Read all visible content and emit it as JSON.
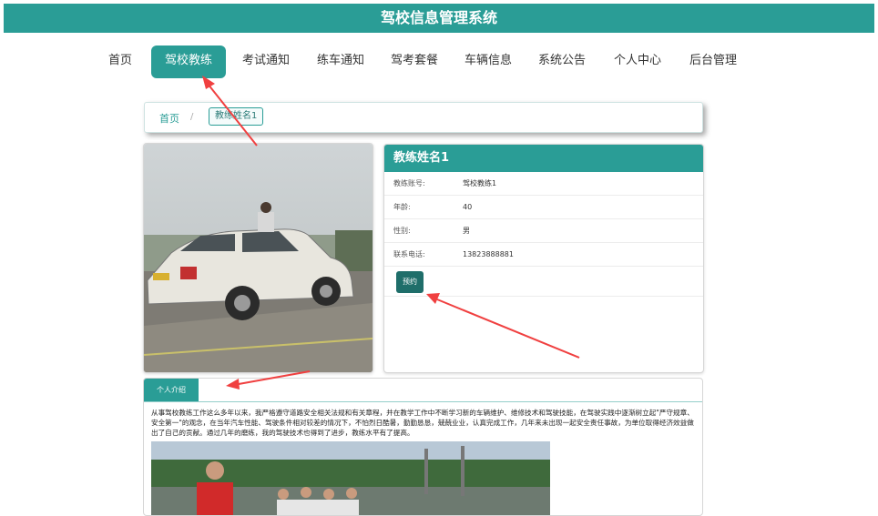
{
  "header": {
    "title": "驾校信息管理系统"
  },
  "nav": {
    "items": [
      {
        "label": "首页"
      },
      {
        "label": "驾校教练"
      },
      {
        "label": "考试通知"
      },
      {
        "label": "练车通知"
      },
      {
        "label": "驾考套餐"
      },
      {
        "label": "车辆信息"
      },
      {
        "label": "系统公告"
      },
      {
        "label": "个人中心"
      },
      {
        "label": "后台管理"
      }
    ],
    "active_index": 1
  },
  "breadcrumb": {
    "home": "首页",
    "separator": "/",
    "current": "教练姓名1"
  },
  "coach": {
    "name": "教练姓名1",
    "fields": [
      {
        "label": "教练账号:",
        "value": "驾校教练1"
      },
      {
        "label": "年龄:",
        "value": "40"
      },
      {
        "label": "性别:",
        "value": "男"
      },
      {
        "label": "联系电话:",
        "value": "13823888881"
      }
    ],
    "book_label": "预约"
  },
  "intro": {
    "tab_label": "个人介绍",
    "text": "从事驾校教练工作这么多年以来，我严格遵守道路安全相关法规和有关章程，并在教学工作中不断学习新的车辆维护、维修技术和驾驶技能，在驾驶实践中逐渐树立起\"严守规章、安全第一\"的观念，在当年汽车性能、驾驶条件相对较差的情况下，不怕烈日酷暑，勤勤恳恳，兢兢业业，认真完成工作，几年来未出现一起安全责任事故，为单位取得经济效益做出了自己的贡献。通过几年的磨练，我的驾驶技术也得到了进步，教练水平有了提高。"
  },
  "colors": {
    "primary": "#2a9d96",
    "button": "#1f6e6a",
    "annotation_arrow": "#f04040"
  },
  "icons": {
    "annotation": "red-arrow-icon"
  }
}
